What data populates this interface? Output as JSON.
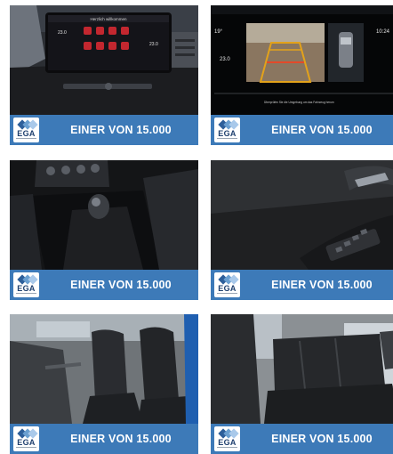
{
  "brand": {
    "logo_text": "EGA",
    "banner_color": "#3d7ab8"
  },
  "tiles": [
    {
      "subject": "infotainment-touchscreen",
      "caption": "EINER VON 15.000",
      "screen": {
        "header": "Herzlich willkommen",
        "left_temp": "23.0",
        "right_temp": "23.0"
      }
    },
    {
      "subject": "rear-view-camera-display",
      "caption": "EINER VON 15.000",
      "screen": {
        "temp_left": "19°",
        "time": "10:24",
        "temp_bottom": "23.0",
        "footer_text": "Überprüfen Sie die Umgebung um das Fahrzeug herum"
      }
    },
    {
      "subject": "center-console-gear-shifter",
      "caption": "EINER VON 15.000"
    },
    {
      "subject": "door-panel-window-switches",
      "caption": "EINER VON 15.000"
    },
    {
      "subject": "front-seats",
      "caption": "EINER VON 15.000"
    },
    {
      "subject": "rear-seats",
      "caption": "EINER VON 15.000"
    }
  ]
}
